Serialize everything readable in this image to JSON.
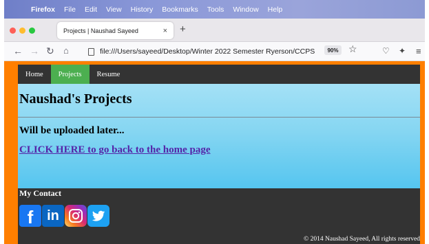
{
  "menubar": {
    "apple_glyph": "",
    "app_name": "Firefox",
    "items": [
      "File",
      "Edit",
      "View",
      "History",
      "Bookmarks",
      "Tools",
      "Window",
      "Help"
    ]
  },
  "tab": {
    "title": "Projects | Naushad Sayeed",
    "close_glyph": "×",
    "new_tab_glyph": "+"
  },
  "navbar": {
    "back_glyph": "←",
    "forward_glyph": "→",
    "reload_glyph": "↻",
    "home_glyph": "⌂",
    "url": "file:///Users/sayeed/Desktop/Winter 2022 Semester Ryerson/CCPS",
    "zoom": "90%",
    "bookmark_glyph": "☆",
    "pocket_glyph": "♡",
    "extensions_glyph": "✦",
    "menu_glyph": "≡"
  },
  "site": {
    "nav": [
      {
        "label": "Home",
        "active": false
      },
      {
        "label": "Projects",
        "active": true
      },
      {
        "label": "Resume",
        "active": false
      }
    ],
    "title": "Naushad's Projects",
    "subtitle": "Will be uploaded later...",
    "back_link": "CLICK HERE to go back to the home page",
    "footer": {
      "contact_title": "My Contact",
      "social": {
        "facebook": "f",
        "linkedin": "in"
      },
      "copyright": "© 2014 Naushad Sayeed, All rights reserved"
    }
  },
  "colors": {
    "page_bg": "#ff7f00",
    "nav_bg": "#333333",
    "nav_active": "#4caf50",
    "hero_top": "#a4e1f6",
    "hero_bottom": "#55c5ef",
    "link": "#5424a8"
  }
}
